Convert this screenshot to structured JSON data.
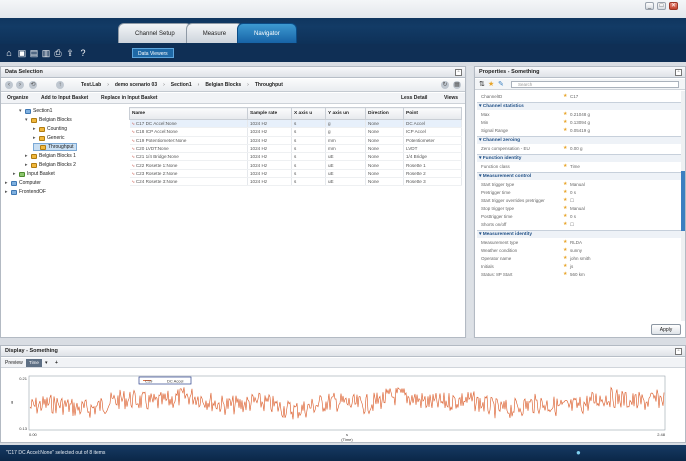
{
  "window": {
    "controls": [
      "_",
      "□",
      "✕"
    ]
  },
  "tabs": [
    {
      "label": "Channel Setup"
    },
    {
      "label": "Measure"
    },
    {
      "label": "Navigator"
    }
  ],
  "toolbar": {
    "data_views_label": "Data Viewers"
  },
  "data_selection": {
    "title": "Data Selection",
    "breadcrumb": [
      "Test.Lab",
      "demo scenario 03",
      "Section1",
      "Belgian Blocks",
      "Throughput"
    ],
    "organize_label": "Organize",
    "add_input_label": "Add to Input Basket",
    "replace_input_label": "Replace in Input Basket",
    "less_detail_label": "Less Detail",
    "views_label": "Views",
    "tree": [
      {
        "label": "Section1",
        "depth": 1,
        "icon": "blue"
      },
      {
        "label": "Belgian Blocks",
        "depth": 2,
        "icon": "yellow"
      },
      {
        "label": "Counting",
        "depth": 3,
        "icon": "yellow"
      },
      {
        "label": "Generic",
        "depth": 3,
        "icon": "yellow"
      },
      {
        "label": "Throughput",
        "depth": 3,
        "icon": "yellow",
        "selected": true
      },
      {
        "label": "Belgian Blocks 1",
        "depth": 2,
        "icon": "yellow"
      },
      {
        "label": "Belgian Blocks 2",
        "depth": 2,
        "icon": "yellow"
      },
      {
        "label": "Input Basket",
        "depth": 1,
        "icon": "green"
      },
      {
        "label": "Computer",
        "depth": 0,
        "icon": "blue"
      },
      {
        "label": "FrontendOF",
        "depth": 0,
        "icon": "blue"
      }
    ],
    "columns": [
      "Name",
      "Sample rate",
      "X axis u",
      "Y axis un",
      "Direction",
      "Point"
    ],
    "rows": [
      [
        "C17 DC Accel:None",
        "1024 Hz",
        "s",
        "g",
        "None",
        "DC Accel"
      ],
      [
        "C18 ICP Accel:None",
        "1024 Hz",
        "s",
        "g",
        "None",
        "ICP Accel"
      ],
      [
        "C19 Potentiometer:None",
        "1024 Hz",
        "s",
        "mm",
        "None",
        "Potentiometer"
      ],
      [
        "C20 LVDT:None",
        "1024 Hz",
        "s",
        "mm",
        "None",
        "LVDT"
      ],
      [
        "C21 1/4 Bridge:None",
        "1024 Hz",
        "s",
        "uE",
        "None",
        "1/4 Bridge"
      ],
      [
        "C22 Rosette 1:None",
        "1024 Hz",
        "s",
        "uE",
        "None",
        "Rosette 1"
      ],
      [
        "C23 Rosette 2:None",
        "1024 Hz",
        "s",
        "uE",
        "None",
        "Rosette 2"
      ],
      [
        "C24 Rosette 3:None",
        "1024 Hz",
        "s",
        "uE",
        "None",
        "Rosette 3"
      ]
    ]
  },
  "properties": {
    "title": "Properties - Something",
    "search_placeholder": "Search",
    "channel_id": {
      "key": "ChannelID",
      "value": "C17"
    },
    "sections": [
      {
        "title": "Channel statistics",
        "rows": [
          [
            "Max",
            "0.21048 g"
          ],
          [
            "Min",
            "0.13094 g"
          ],
          [
            "Signal Range",
            "0.05419 g"
          ]
        ]
      },
      {
        "title": "Channel zeroing",
        "rows": [
          [
            "Zero compensation - EU",
            "0.00 g"
          ]
        ]
      },
      {
        "title": "Function identity",
        "rows": [
          [
            "Function class",
            "Time"
          ]
        ]
      },
      {
        "title": "Measurement control",
        "rows": [
          [
            "Start trigger type",
            "Manual"
          ],
          [
            "Pretrigger time",
            "0 s"
          ],
          [
            "Start trigger overrides pretrigger",
            "☐"
          ],
          [
            "Stop trigger type",
            "Manual"
          ],
          [
            "Posttrigger time",
            "0 s"
          ],
          [
            "Shorts on/off",
            "☐"
          ]
        ]
      },
      {
        "title": "Measurement identity",
        "rows": [
          [
            "Measurement type",
            "RLDA"
          ],
          [
            "Weather condition",
            "sunny"
          ],
          [
            "Operator name",
            "john smith"
          ],
          [
            "Initials",
            "js"
          ],
          [
            "Status: 8P Start",
            "560 km"
          ]
        ]
      }
    ],
    "apply_label": "Apply"
  },
  "display": {
    "title": "Display - Something",
    "preview_label": "Preview",
    "time_chip": "Time",
    "legend": [
      "C19",
      "DC Accel"
    ],
    "y_ticks": [
      "0.21",
      "0.13"
    ],
    "y_label": "g",
    "x_start": "0.00",
    "x_end": "2.48",
    "x_label": "s",
    "x_unit_label": "(Time)"
  },
  "chart_data": {
    "type": "line",
    "title": "",
    "xlabel": "s (Time)",
    "ylabel": "g",
    "xlim": [
      0.0,
      2.48
    ],
    "ylim": [
      0.13,
      0.21
    ],
    "series": [
      {
        "name": "DC Accel",
        "color": "#d9531e"
      }
    ]
  },
  "status": {
    "text": "\"C17 DC Accel:None\" selected out of 8 items"
  }
}
